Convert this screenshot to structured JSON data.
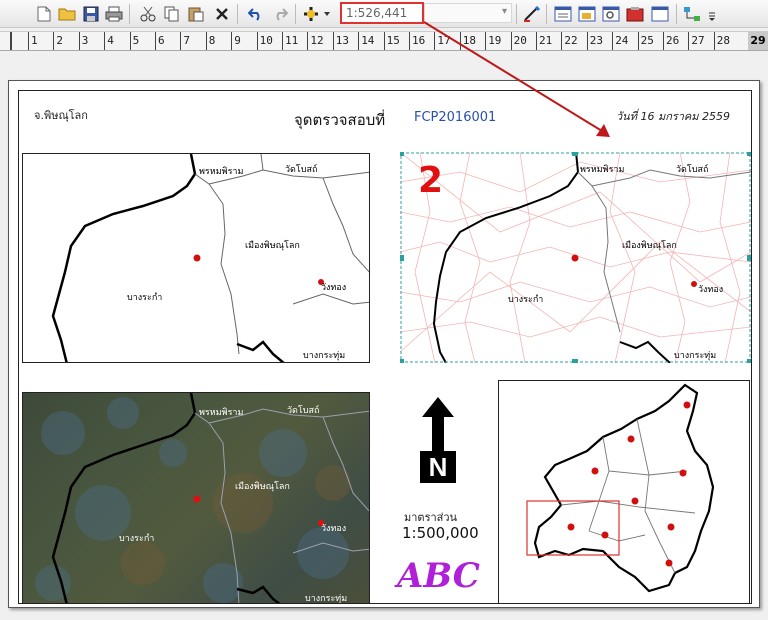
{
  "toolbar": {
    "buttons": [
      "new-document-icon",
      "open-folder-icon",
      "save-icon",
      "print-icon",
      "cut-icon",
      "copy-icon",
      "paste-icon",
      "delete-icon",
      "undo-icon",
      "redo-icon",
      "add-data-icon"
    ],
    "scale_value": "1:526,441",
    "scale_input_border": "#e03030"
  },
  "ruler": {
    "labels": [
      "1",
      "2",
      "3",
      "4",
      "5",
      "6",
      "7",
      "8",
      "9",
      "10",
      "11",
      "12",
      "13",
      "14",
      "15",
      "16",
      "17",
      "18",
      "19",
      "20",
      "21",
      "22",
      "23",
      "24",
      "25",
      "26",
      "27",
      "28"
    ],
    "end_label": "29"
  },
  "layout": {
    "province": "จ.พิษณุโลก",
    "title": "จุดตรวจสอบที่",
    "code": "FCP2016001",
    "date": "วันที่ 16 มกราคม 2559",
    "callout_number": "2",
    "scale_label": "มาตราส่วน",
    "scale_value": "1:500,000",
    "logo_text": "ABC",
    "north_letter": "N"
  },
  "map_labels": {
    "phrom": "พรหมพิราม",
    "wat_bot": "วัดโบสถ์",
    "mueang": "เมืองพิษณุโลก",
    "bang_rakam": "บางระกำ",
    "wang_thong": "วังทอง",
    "bang_krathum": "บางกระทุ่ม"
  },
  "colors": {
    "accent_blue": "#2a4fb0",
    "dot_red": "#d01010",
    "selection_cyan": "#2aa0a0",
    "inset_box": "#e03030",
    "logo_purple": "#b020d8",
    "arrow_red": "#c01818"
  }
}
